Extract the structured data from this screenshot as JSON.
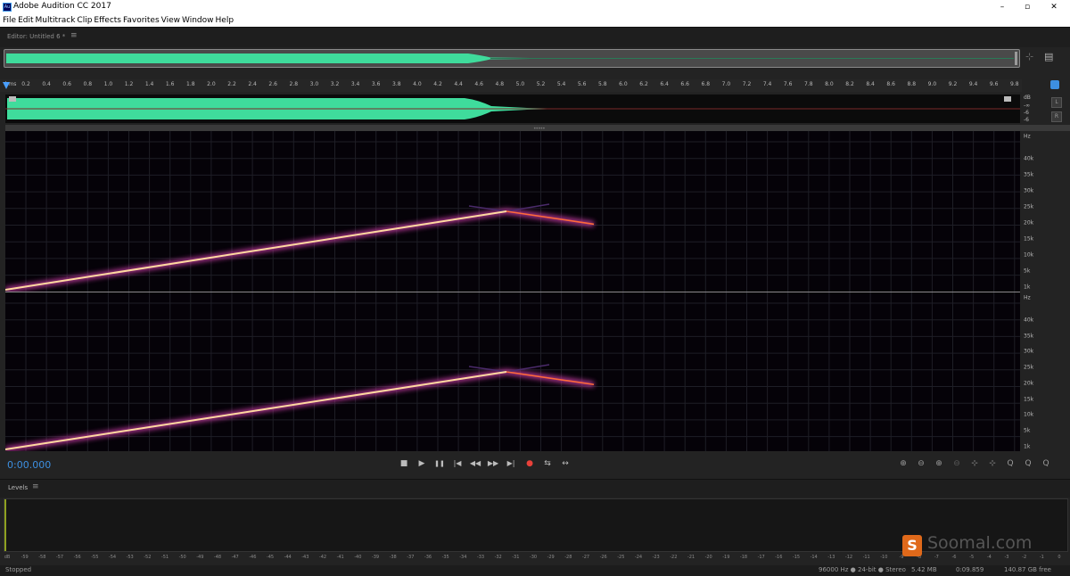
{
  "window": {
    "title": "Adobe Audition CC 2017",
    "app_icon_text": "Au",
    "minimize": "–",
    "maximize": "▫",
    "close": "✕"
  },
  "menubar": [
    "File",
    "Edit",
    "Multitrack",
    "Clip",
    "Effects",
    "Favorites",
    "View",
    "Window",
    "Help"
  ],
  "editor": {
    "title": "Editor: Untitled 6 *",
    "menu_icon": "≡"
  },
  "ruler": {
    "unit_label": "hms",
    "ticks": [
      "0.2",
      "0.4",
      "0.6",
      "0.8",
      "1.0",
      "1.2",
      "1.4",
      "1.6",
      "1.8",
      "2.0",
      "2.2",
      "2.4",
      "2.6",
      "2.8",
      "3.0",
      "3.2",
      "3.4",
      "3.6",
      "3.8",
      "4.0",
      "4.2",
      "4.4",
      "4.6",
      "4.8",
      "5.0",
      "5.2",
      "5.4",
      "5.6",
      "5.8",
      "6.0",
      "6.2",
      "6.4",
      "6.6",
      "6.8",
      "7.0",
      "7.2",
      "7.4",
      "7.6",
      "7.8",
      "8.0",
      "8.2",
      "8.4",
      "8.6",
      "8.8",
      "9.0",
      "9.2",
      "9.4",
      "9.6",
      "9.8"
    ]
  },
  "waveform_scale": {
    "unit": "dB",
    "labels": [
      "-∞",
      "-6",
      "-6"
    ],
    "channel_left": "L",
    "channel_right": "R"
  },
  "spectral_scale": {
    "unit": "Hz",
    "labels": [
      "40k",
      "35k",
      "30k",
      "25k",
      "20k",
      "15k",
      "10k",
      "5k",
      "1k"
    ]
  },
  "transport": {
    "time": "0:00.000",
    "buttons": [
      "■",
      "▶",
      "❚❚",
      "|◀",
      "◀◀",
      "▶▶",
      "▶|",
      "●",
      "⇆",
      "↔"
    ],
    "record_color": "#e8413a"
  },
  "zoom_buttons": [
    "⊕",
    "⊖",
    "⊕",
    "⊖",
    "⊹",
    "⊹",
    "Q",
    "Q",
    "Q"
  ],
  "levels": {
    "title": "Levels",
    "menu_icon": "≡",
    "scale": [
      "dB",
      "-59",
      "-58",
      "-57",
      "-56",
      "-55",
      "-54",
      "-53",
      "-52",
      "-51",
      "-50",
      "-49",
      "-48",
      "-47",
      "-46",
      "-45",
      "-44",
      "-43",
      "-42",
      "-41",
      "-40",
      "-39",
      "-38",
      "-37",
      "-36",
      "-35",
      "-34",
      "-33",
      "-32",
      "-31",
      "-30",
      "-29",
      "-28",
      "-27",
      "-26",
      "-25",
      "-24",
      "-23",
      "-22",
      "-21",
      "-20",
      "-19",
      "-18",
      "-17",
      "-16",
      "-15",
      "-14",
      "-13",
      "-12",
      "-11",
      "-10",
      "-9",
      "-8",
      "-7",
      "-6",
      "-5",
      "-4",
      "-3",
      "-2",
      "-1",
      "0"
    ]
  },
  "status": {
    "state": "Stopped",
    "format": "96000 Hz ● 24-bit ● Stereo",
    "size": "5.42 MB",
    "duration": "0:09.859",
    "free": "140.87 GB free"
  },
  "colors": {
    "waveform": "#3fdc9c",
    "accent_blue": "#3d8fe0",
    "sweep_core": "#ffd9a0",
    "sweep_glow": "#c23aa0"
  },
  "watermark": {
    "logo_letter": "S",
    "text": "Soomal.com"
  }
}
